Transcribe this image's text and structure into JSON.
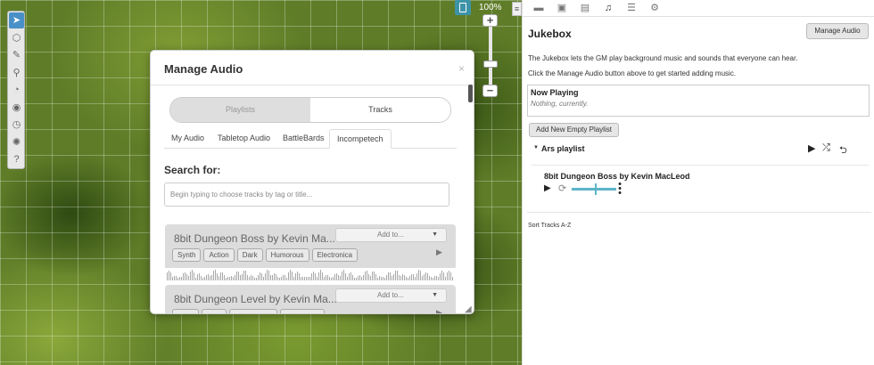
{
  "map": {
    "zoom_label": "100%",
    "zoom_in_symbol": "+",
    "zoom_out_symbol": "−",
    "menu_symbol": "≡",
    "tools": [
      {
        "name": "select-tool-icon",
        "glyph": "➤"
      },
      {
        "name": "shapes-tool-icon",
        "glyph": "⬡"
      },
      {
        "name": "draw-tool-icon",
        "glyph": "✎"
      },
      {
        "name": "zoom-tool-icon",
        "glyph": "⚲"
      },
      {
        "name": "measure-tool-icon",
        "glyph": "◔"
      },
      {
        "name": "eye-tool-icon",
        "glyph": "◉"
      },
      {
        "name": "clock-tool-icon",
        "glyph": "◷"
      },
      {
        "name": "fx-tool-icon",
        "glyph": "✺"
      },
      {
        "name": "help-tool-icon",
        "glyph": "?"
      }
    ]
  },
  "modal": {
    "title": "Manage Audio",
    "close_symbol": "×",
    "segments": {
      "playlists": "Playlists",
      "tracks": "Tracks"
    },
    "tabs": [
      "My Audio",
      "Tabletop Audio",
      "BattleBards",
      "Incompetech"
    ],
    "search_label": "Search for:",
    "search_placeholder": "Begin typing to choose tracks by tag or title...",
    "tracks": [
      {
        "title": "8bit Dungeon Boss by Kevin Ma...",
        "add_to": "Add to...",
        "tags": [
          "Synth",
          "Action",
          "Dark",
          "Humorous",
          "Electronica"
        ]
      },
      {
        "title": "8bit Dungeon Level by Kevin Ma...",
        "add_to": "Add to...",
        "tags": [
          "",
          "",
          "",
          ""
        ]
      }
    ]
  },
  "sidebar": {
    "icons": [
      "chat-icon",
      "art-library-icon",
      "journal-icon",
      "jukebox-icon",
      "compendium-icon",
      "settings-icon"
    ],
    "title": "Jukebox",
    "manage_button": "Manage Audio",
    "description_1": "The Jukebox lets the GM play background music and sounds that everyone can hear.",
    "description_2": "Click the Manage Audio button above to get started adding music.",
    "now_playing_label": "Now Playing",
    "now_playing_value": "Nothing, currently.",
    "add_playlist_button": "Add New Empty Playlist",
    "playlist": {
      "name": "Ars playlist",
      "play_symbol": "▶",
      "shuffle_symbol": "⤮",
      "exit_symbol": "⮌"
    },
    "track": {
      "name": "8bit Dungeon Boss by Kevin MacLeod",
      "play_symbol": "▶",
      "loop_symbol": "⟳",
      "volume": 0.55
    },
    "sort_link": "Sort Tracks A-Z"
  }
}
